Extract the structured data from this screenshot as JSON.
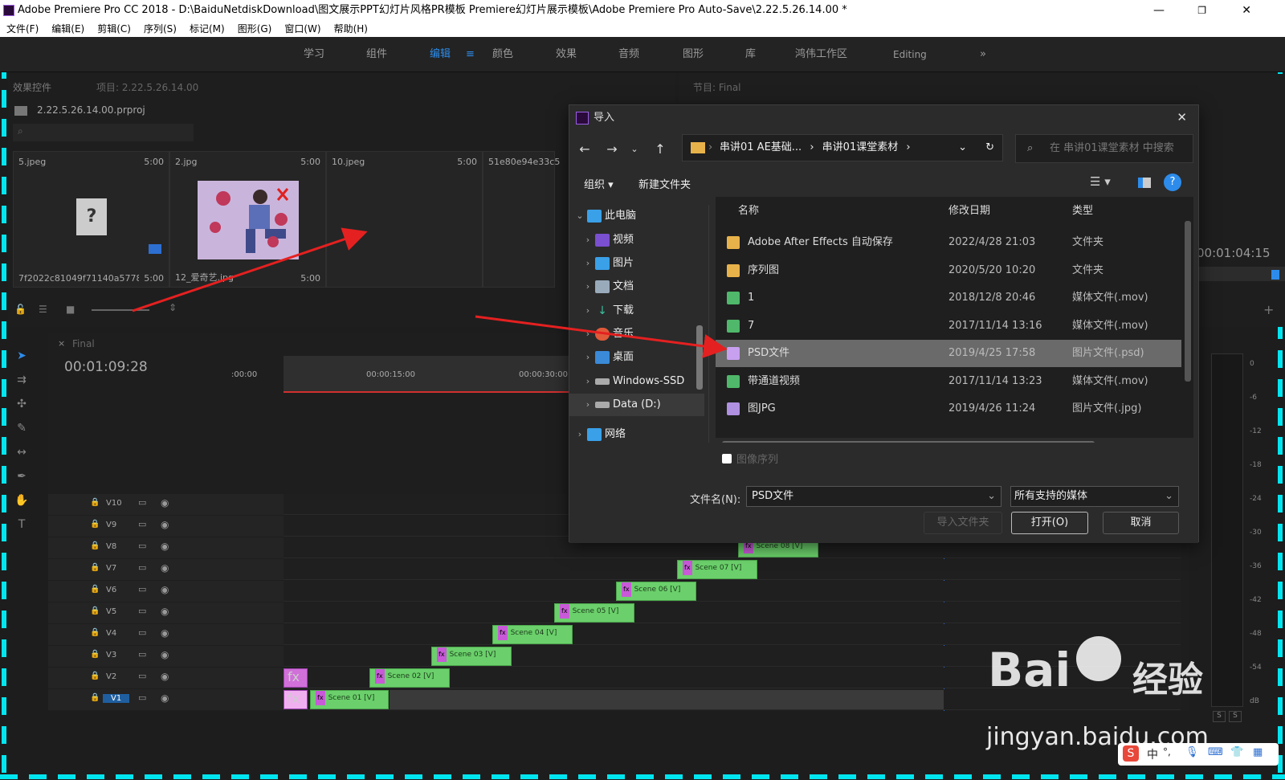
{
  "window": {
    "title": "Adobe Premiere Pro CC 2018 - D:\\BaiduNetdiskDownload\\图文展示PPT幻灯片风格PR模板 Premiere幻灯片展示模板\\Adobe Premiere Pro Auto-Save\\2.22.5.26.14.00 *"
  },
  "menu": [
    "文件(F)",
    "编辑(E)",
    "剪辑(C)",
    "序列(S)",
    "标记(M)",
    "图形(G)",
    "窗口(W)",
    "帮助(H)"
  ],
  "workspaces": [
    "学习",
    "组件",
    "编辑",
    "颜色",
    "效果",
    "音频",
    "图形",
    "库",
    "鸿伟工作区",
    "Editing"
  ],
  "workspace_active": "编辑",
  "project": {
    "tab_effects": "效果控件",
    "tab_project": "项目: 2.22.5.26.14.00",
    "file": "2.22.5.26.14.00.prproj",
    "items": [
      {
        "name": "5.jpeg",
        "duration": "5:00",
        "caption": "7f2022c81049f71140a5778...",
        "caption_dur": "5:00"
      },
      {
        "name": "2.jpg",
        "duration": "5:00",
        "caption": "12_爱奇艺.jpg",
        "caption_dur": "5:00"
      },
      {
        "name": "10.jpeg",
        "duration": "5:00"
      },
      {
        "name": "51e80e94e33c5",
        "duration": ""
      }
    ]
  },
  "program": {
    "tab": "节目: Final",
    "timecode": "00:01:04:15"
  },
  "timeline": {
    "tab": "Final",
    "timecode": "00:01:09:28",
    "ruler": [
      ":00:00",
      "00:00:15:00",
      "00:00:30:00"
    ],
    "tracks": [
      "V10",
      "V9",
      "V8",
      "V7",
      "V6",
      "V5",
      "V4",
      "V3",
      "V2",
      "V1"
    ],
    "clips": [
      "Scene 01 [V]",
      "Scene 02 [V]",
      "Scene 03 [V]",
      "Scene 04 [V]",
      "Scene 05 [V]",
      "Scene 06 [V]",
      "Scene 07 [V]",
      "Scene 08 [V]"
    ],
    "fx": "fx"
  },
  "meter": {
    "ticks": [
      "0",
      "-6",
      "-12",
      "-18",
      "-24",
      "-30",
      "-36",
      "-42",
      "-48",
      "-54",
      "dB"
    ],
    "solo": "S"
  },
  "dialog": {
    "title": "导入",
    "breadcrumb": [
      "串讲01  AE基础...",
      "串讲01课堂素材"
    ],
    "search_placeholder": "在 串讲01课堂素材 中搜索",
    "organize": "组织 ▾",
    "new_folder": "新建文件夹",
    "tree": [
      "此电脑",
      "视频",
      "图片",
      "文档",
      "下载",
      "音乐",
      "桌面",
      "Windows-SSD",
      "Data (D:)",
      "网络"
    ],
    "columns": [
      "名称",
      "修改日期",
      "类型"
    ],
    "files": [
      {
        "name": "Adobe After Effects 自动保存",
        "date": "2022/4/28 21:03",
        "type": "文件夹",
        "icon": "folder"
      },
      {
        "name": "序列图",
        "date": "2020/5/20 10:20",
        "type": "文件夹",
        "icon": "folder"
      },
      {
        "name": "1",
        "date": "2018/12/8 20:46",
        "type": "媒体文件(.mov)",
        "icon": "mov"
      },
      {
        "name": "7",
        "date": "2017/11/14 13:16",
        "type": "媒体文件(.mov)",
        "icon": "mov"
      },
      {
        "name": "PSD文件",
        "date": "2019/4/25 17:58",
        "type": "图片文件(.psd)",
        "icon": "psd"
      },
      {
        "name": "带通道视频",
        "date": "2017/11/14 13:23",
        "type": "媒体文件(.mov)",
        "icon": "mov"
      },
      {
        "name": "图JPG",
        "date": "2019/4/26 11:24",
        "type": "图片文件(.jpg)",
        "icon": "jpg"
      }
    ],
    "selected_index": 4,
    "image_sequence": "图像序列",
    "filename_label": "文件名(N):",
    "filename_value": "PSD文件",
    "filter": "所有支持的媒体",
    "import_folder": "导入文件夹",
    "open": "打开(O)",
    "cancel": "取消"
  },
  "watermark": {
    "brand": "Bai",
    "brand2": "经验",
    "url": "jingyan.baidu.com"
  },
  "ime": [
    "中",
    "°,"
  ],
  "colors": {
    "accent": "#2d8ceb",
    "clip": "#6bd06b",
    "arrow": "#e52020",
    "dashes": "#00e6f0",
    "selection": "#6a6a6a"
  }
}
